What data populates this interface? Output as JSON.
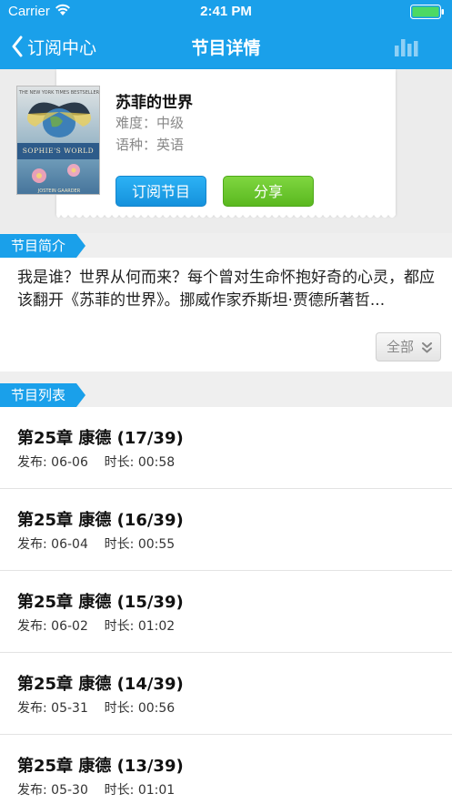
{
  "status_bar": {
    "carrier": "Carrier",
    "time": "2:41 PM"
  },
  "nav": {
    "back_label": "订阅中心",
    "title": "节目详情"
  },
  "program": {
    "title": "苏菲的世界",
    "difficulty": "难度：中级",
    "language": "语种：英语",
    "cover": {
      "top_text": "THE NEW YORK TIMES BESTSELLER",
      "band_text": "SOPHIE'S WORLD",
      "author": "JOSTEIN GAARDER"
    },
    "subscribe_label": "订阅节目",
    "share_label": "分享"
  },
  "intro": {
    "section_title": "节目简介",
    "text": "我是谁？世界从何而来？每个曾对生命怀抱好奇的心灵，都应该翻开《苏菲的世界》。挪威作家乔斯坦·贾德所著哲...",
    "more_label": "全部"
  },
  "list": {
    "section_title": "节目列表",
    "items": [
      {
        "title": "第25章 康德 (17/39)",
        "meta": "发布: 06-06    时长: 00:58"
      },
      {
        "title": "第25章 康德 (16/39)",
        "meta": "发布: 06-04    时长: 00:55"
      },
      {
        "title": "第25章 康德 (15/39)",
        "meta": "发布: 06-02    时长: 01:02"
      },
      {
        "title": "第25章 康德 (14/39)",
        "meta": "发布: 05-31    时长: 00:56"
      },
      {
        "title": "第25章 康德 (13/39)",
        "meta": "发布: 05-30    时长: 01:01"
      }
    ]
  },
  "colors": {
    "primary": "#1aa0ea",
    "share": "#5ab81f"
  },
  "icons": [
    "wifi-icon",
    "battery-icon",
    "back-chevron-icon",
    "stats-icon",
    "chevron-double-down-icon"
  ]
}
